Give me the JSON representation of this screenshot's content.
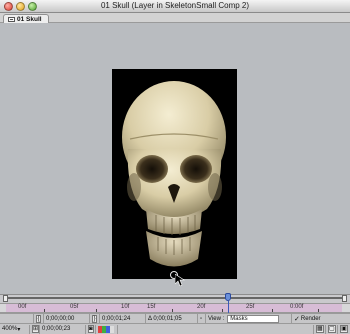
{
  "window": {
    "title": "01 Skull (Layer in SkeletonSmall Comp 2)"
  },
  "tab": {
    "label": "01 Skull"
  },
  "ruler": {
    "labels": [
      "00f",
      "05f",
      "10f",
      "15f",
      "20f",
      "25f",
      "0:00f"
    ]
  },
  "controls": {
    "in_point": "0;00;00;00",
    "out_point": "0;00;01;24",
    "duration": "Δ 0;00;01;05",
    "view_label": "View :",
    "view_value": "Masks",
    "render_label": "Render",
    "zoom": "400%",
    "current_time": "0;00;00;23"
  },
  "colors": {
    "work_area": "#d7bcd6",
    "time_indicator": "#6a8fd8",
    "channel_swatches": [
      "#e04040",
      "#40b040",
      "#4060e0",
      "#dddddd"
    ]
  }
}
